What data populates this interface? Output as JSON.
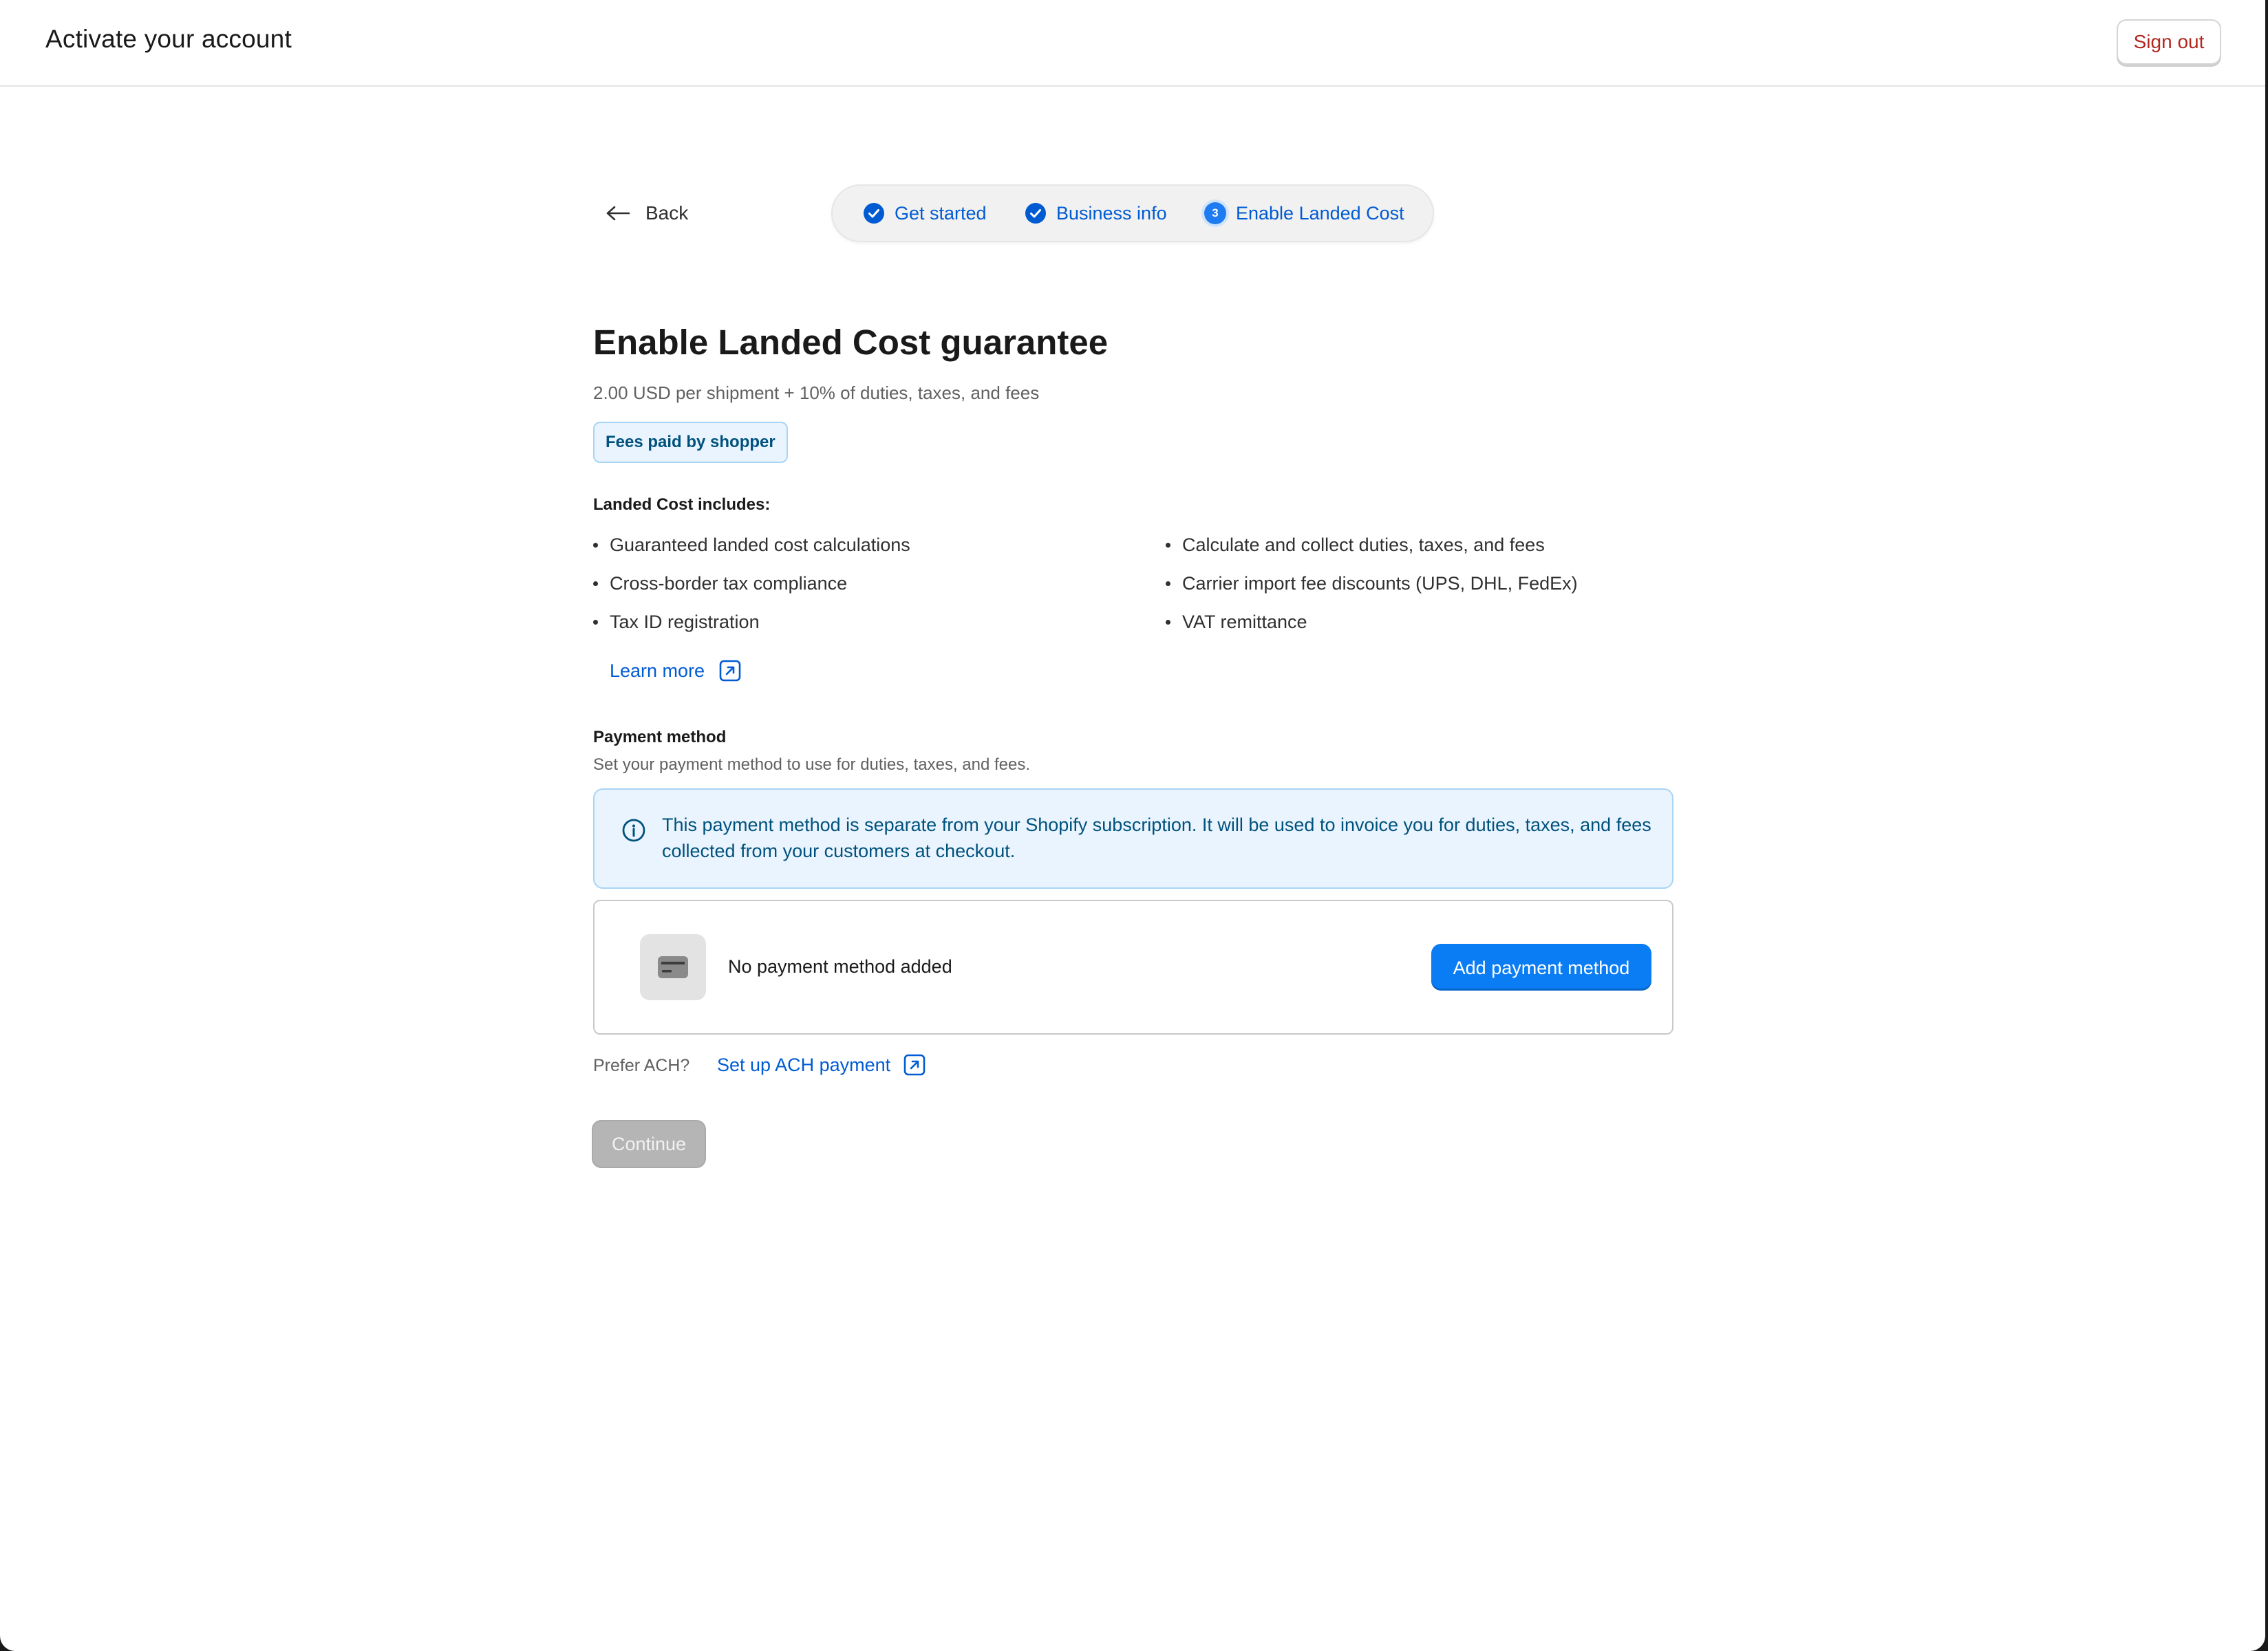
{
  "header": {
    "title": "Activate your account",
    "sign_out_label": "Sign out"
  },
  "nav": {
    "back_label": "Back",
    "steps": [
      {
        "label": "Get started",
        "state": "complete"
      },
      {
        "label": "Business info",
        "state": "complete"
      },
      {
        "label": "Enable Landed Cost",
        "state": "current",
        "number": "3"
      }
    ]
  },
  "main": {
    "title": "Enable Landed Cost guarantee",
    "pricing": "2.00 USD per shipment + 10% of duties, taxes, and fees",
    "badge": "Fees paid by shopper",
    "includes_title": "Landed Cost includes:",
    "includes_left": [
      "Guaranteed landed cost calculations",
      "Cross-border tax compliance",
      "Tax ID registration"
    ],
    "includes_right": [
      "Calculate and collect duties, taxes, and fees",
      "Carrier import fee discounts (UPS, DHL, FedEx)",
      "VAT remittance"
    ],
    "learn_more_label": "Learn more"
  },
  "payment": {
    "title": "Payment method",
    "subtitle": "Set your payment method to use for duties, taxes, and fees.",
    "info_banner": "This payment method is separate from your Shopify subscription. It will be used to invoice you for duties, taxes, and fees collected from your customers at checkout.",
    "empty_label": "No payment method added",
    "add_button_label": "Add payment method",
    "prefer_ach": "Prefer ACH?",
    "ach_link_label": "Set up ACH payment"
  },
  "footer": {
    "continue_label": "Continue",
    "continue_disabled": true
  },
  "colors": {
    "link": "#005bd3",
    "primary_button": "#0a7cf4",
    "sign_out_text": "#b3261e",
    "info_background": "#eaf4ff",
    "disabled_button": "#b5b5b5"
  }
}
